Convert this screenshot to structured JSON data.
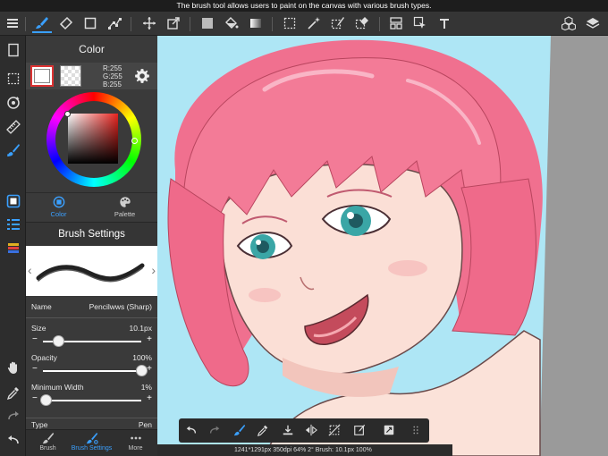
{
  "status_tip": "The brush tool allows users to paint on the canvas with various brush types.",
  "top_toolbar": {
    "icons": [
      "menu-icon",
      "brush-icon",
      "eraser-icon",
      "rect-shape-icon",
      "vector-node-icon",
      "move-icon",
      "transform-icon",
      "fill-color-icon",
      "bucket-icon",
      "gradient-icon",
      "select-rect-icon",
      "magic-wand-icon",
      "select-pen-icon",
      "select-eraser-icon",
      "layout-icon",
      "pointer-select-icon",
      "text-icon",
      "materials-icon",
      "layers-icon"
    ]
  },
  "color_panel": {
    "title": "Color",
    "rgb": {
      "r": "R:255",
      "g": "G:255",
      "b": "B:255"
    },
    "tabs": [
      {
        "label": "Color"
      },
      {
        "label": "Palette"
      }
    ],
    "primary_color": "#ffffff",
    "hue_color": "#e8241f"
  },
  "brush_settings": {
    "title": "Brush Settings",
    "name_label": "Name",
    "name_value": "Pencilwws (Sharp)",
    "size_label": "Size",
    "size_value": "10.1px",
    "size_level": 0.16,
    "opacity_label": "Opacity",
    "opacity_value": "100%",
    "opacity_level": 1.0,
    "min_width_label": "Minimum Width",
    "min_width_value": "1%",
    "min_width_level": 0.03,
    "type_label": "Type",
    "type_value": "Pen"
  },
  "bottom_tabs": [
    {
      "label": "Brush"
    },
    {
      "label": "Brush Settings"
    },
    {
      "label": "More"
    }
  ],
  "canvas_info": "1241*1291px 350dpi 64% 2° Brush: 10.1px 100%",
  "colors": {
    "accent": "#3aa0ff",
    "canvas_bg": "#aee6f5",
    "hair": "#f0708f"
  }
}
